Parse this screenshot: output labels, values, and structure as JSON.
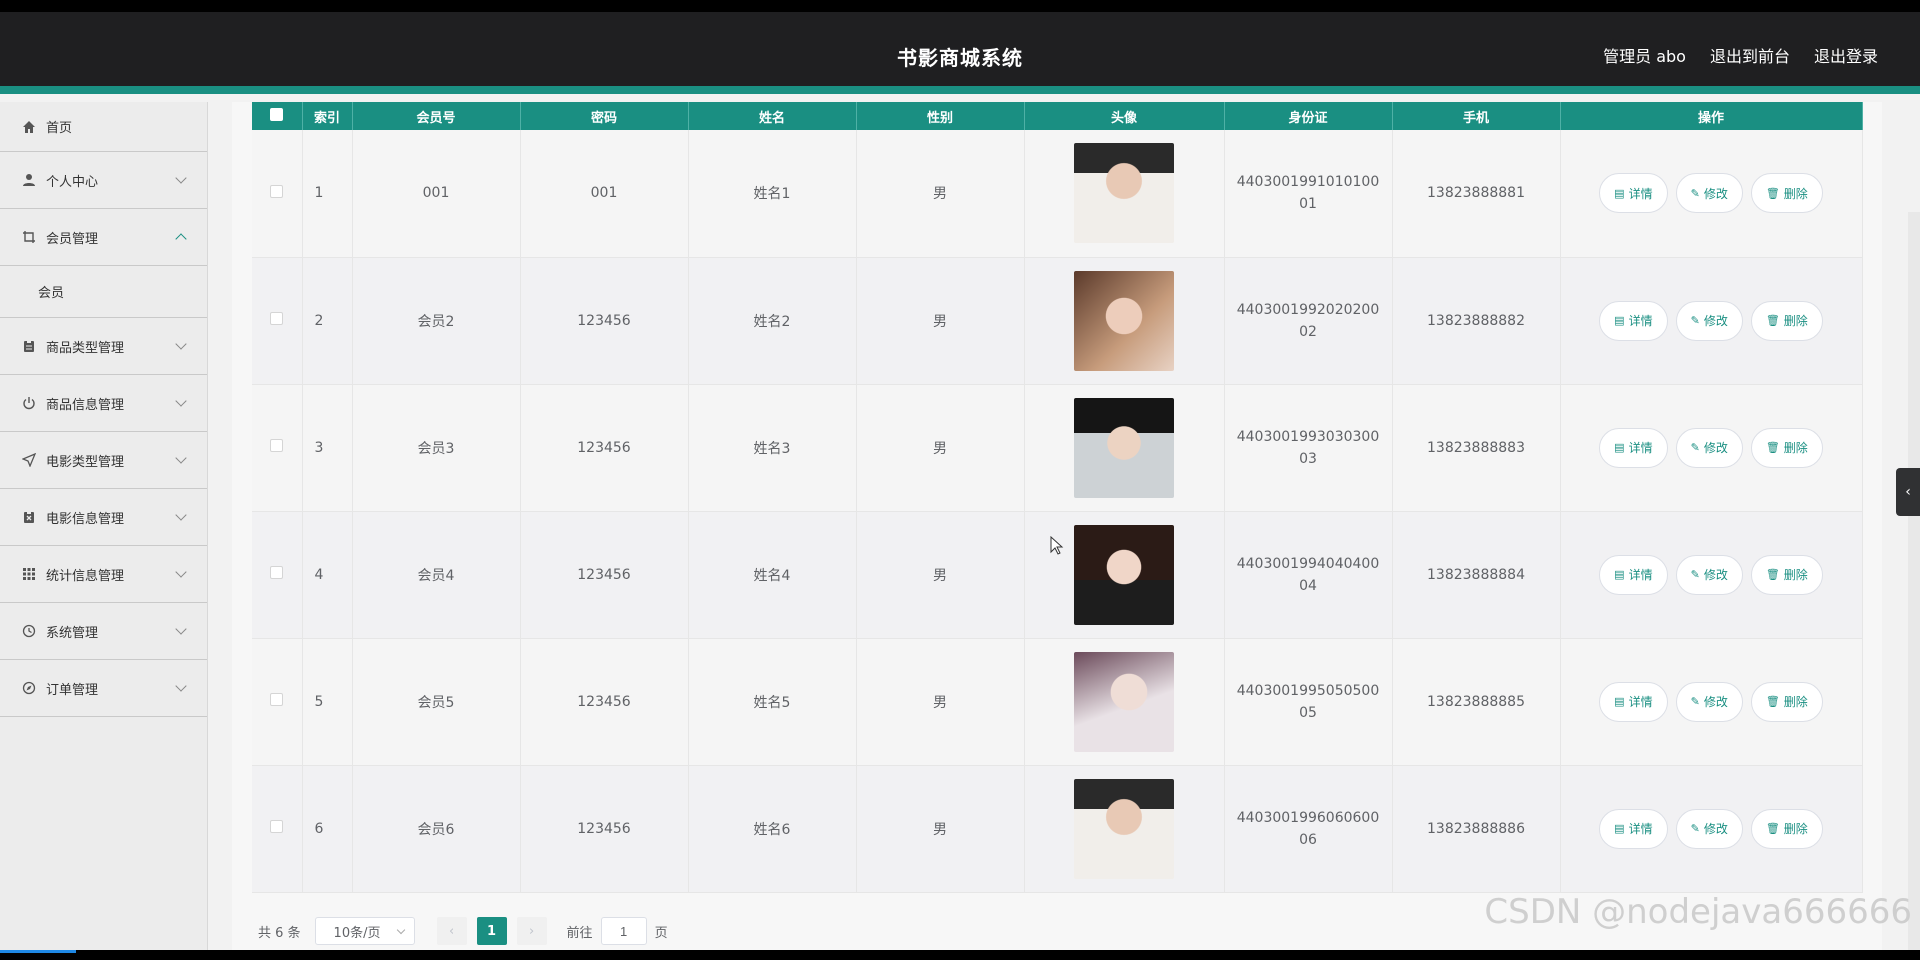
{
  "header": {
    "title": "书影商城系统",
    "links": [
      "管理员 abo",
      "退出到前台",
      "退出登录"
    ]
  },
  "sidebar": {
    "items": [
      {
        "label": "首页",
        "icon": "home-icon"
      },
      {
        "label": "个人中心",
        "icon": "user-icon"
      },
      {
        "label": "会员管理",
        "icon": "crop-icon",
        "expanded": true
      },
      {
        "label": "商品类型管理",
        "icon": "clipboard-icon"
      },
      {
        "label": "商品信息管理",
        "icon": "power-icon"
      },
      {
        "label": "电影类型管理",
        "icon": "send-icon"
      },
      {
        "label": "电影信息管理",
        "icon": "clipboard-x-icon"
      },
      {
        "label": "统计信息管理",
        "icon": "grid-icon"
      },
      {
        "label": "系统管理",
        "icon": "clock-icon"
      },
      {
        "label": "订单管理",
        "icon": "compass-icon"
      }
    ],
    "sub_item": "会员"
  },
  "table": {
    "headers": [
      "索引",
      "会员号",
      "密码",
      "姓名",
      "性别",
      "头像",
      "身份证",
      "手机",
      "操作"
    ],
    "rows": [
      {
        "index": "1",
        "member_no": "001",
        "password": "001",
        "name": "姓名1",
        "gender": "男",
        "id_card": "440300199101010001",
        "phone": "13823888881"
      },
      {
        "index": "2",
        "member_no": "会员2",
        "password": "123456",
        "name": "姓名2",
        "gender": "男",
        "id_card": "440300199202020002",
        "phone": "13823888882"
      },
      {
        "index": "3",
        "member_no": "会员3",
        "password": "123456",
        "name": "姓名3",
        "gender": "男",
        "id_card": "440300199303030003",
        "phone": "13823888883"
      },
      {
        "index": "4",
        "member_no": "会员4",
        "password": "123456",
        "name": "姓名4",
        "gender": "男",
        "id_card": "440300199404040004",
        "phone": "13823888884"
      },
      {
        "index": "5",
        "member_no": "会员5",
        "password": "123456",
        "name": "姓名5",
        "gender": "男",
        "id_card": "440300199505050005",
        "phone": "13823888885"
      },
      {
        "index": "6",
        "member_no": "会员6",
        "password": "123456",
        "name": "姓名6",
        "gender": "男",
        "id_card": "440300199606060006",
        "phone": "13823888886"
      }
    ],
    "actions": {
      "detail": "详情",
      "edit": "修改",
      "delete": "删除"
    }
  },
  "pager": {
    "total": "共 6 条",
    "page_size": "10条/页",
    "current_page": "1",
    "goto_label": "前往",
    "goto_value": "1",
    "page_unit": "页"
  },
  "watermark": "CSDN @nodejava666666",
  "colors": {
    "accent": "#1a8f82",
    "header_bg": "#1f1f21"
  }
}
